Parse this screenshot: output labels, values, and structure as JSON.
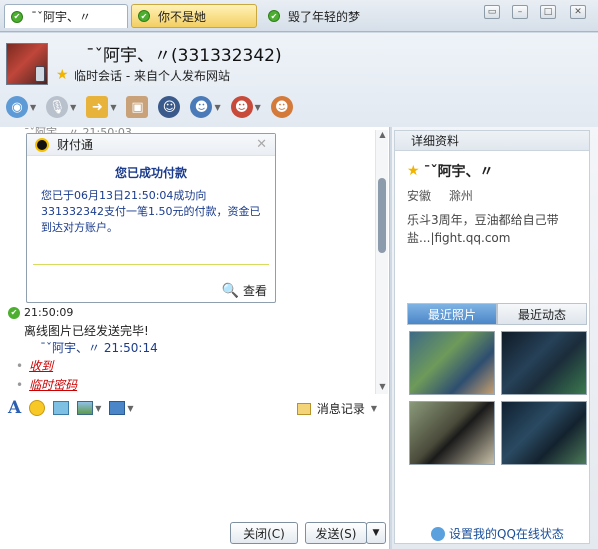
{
  "tabs": [
    {
      "label": "ˉˇ阿宇、〃"
    },
    {
      "label": "你不是她"
    },
    {
      "label": "毁了年轻的梦"
    }
  ],
  "header": {
    "contact_name": "ˉˇ阿宇、〃(331332342)",
    "session_info": "临时会话 - 来自个人发布网站"
  },
  "chat": {
    "cut_off_text": "ˉˇ阿宇、〃  21:50:03",
    "card": {
      "header": "财付通",
      "title": "您已成功付款",
      "body": "您已于06月13日21:50:04成功向331332342支付一笔1.50元的付款，资金已到达对方账户。",
      "view_label": "查看"
    },
    "message_time": "21:50:09",
    "message_text": "离线图片已经发送完毕!",
    "sender_line": "ˉˇ阿宇、〃   21:50:14",
    "links": [
      "收到",
      "临时密码"
    ]
  },
  "input_toolbar": {
    "history_label": "消息记录"
  },
  "bottom": {
    "close_label": "关闭(C)",
    "send_label": "发送(S)"
  },
  "side": {
    "title": "详细资料",
    "name": "ˉˇ阿宇、〃",
    "province": "安徽",
    "city": "滁州",
    "signature": "乐斗3周年，豆油都给自己带盐...|fight.qq.com",
    "tabs": [
      "最近照片",
      "最近动态"
    ],
    "online_status_link": "设置我的QQ在线状态"
  }
}
